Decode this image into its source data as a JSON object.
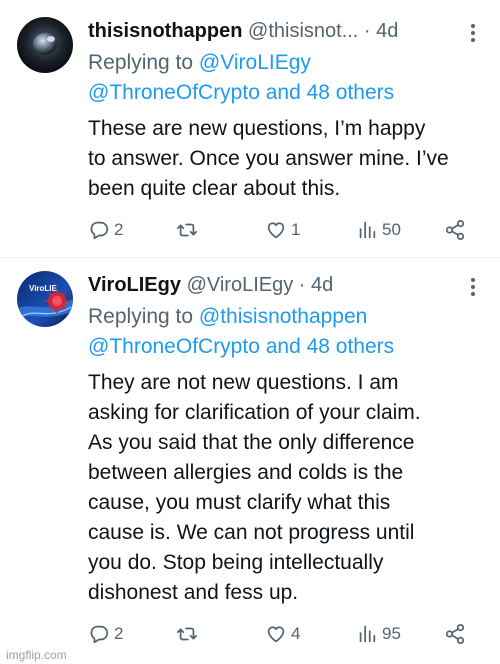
{
  "tweets": [
    {
      "name": "thisisnothappen",
      "handle": "@thisisnot...",
      "time": "· 4d",
      "replying_label": "Replying to",
      "replying_line1": "@ViroLIEgy",
      "replying_line2": "@ThroneOfCrypto and 48 others",
      "text_lines": [
        "These are new questions, I’m happy",
        "to answer. Once you answer mine. I’ve",
        "been quite clear about this."
      ],
      "replies": "2",
      "retweets": "",
      "likes": "1",
      "views": "50"
    },
    {
      "name": "ViroLIEgy",
      "handle": "@ViroLIEgy",
      "time": "· 4d",
      "avatar_text": "ViroLIE",
      "replying_label": "Replying to",
      "replying_line1": "@thisisnothappen",
      "replying_line2": "@ThroneOfCrypto and 48 others",
      "text_lines": [
        "They are not new questions. I am",
        "asking for clarification of your claim.",
        "As you said that the only difference",
        "between allergies and colds is the",
        "cause, you must clarify what this",
        "cause is. We can not progress until",
        "you do. Stop being intellectually",
        "dishonest and fess up."
      ],
      "replies": "2",
      "retweets": "",
      "likes": "4",
      "views": "95"
    }
  ],
  "icons": {
    "reply": "reply-icon",
    "retweet": "retweet-icon",
    "like": "heart-icon",
    "views": "views-icon",
    "share": "share-icon",
    "more": "more-icon"
  },
  "colors": {
    "link": "#1d9bf0",
    "secondary": "#536471",
    "text": "#0f1419"
  },
  "watermark": "imgflip.com"
}
